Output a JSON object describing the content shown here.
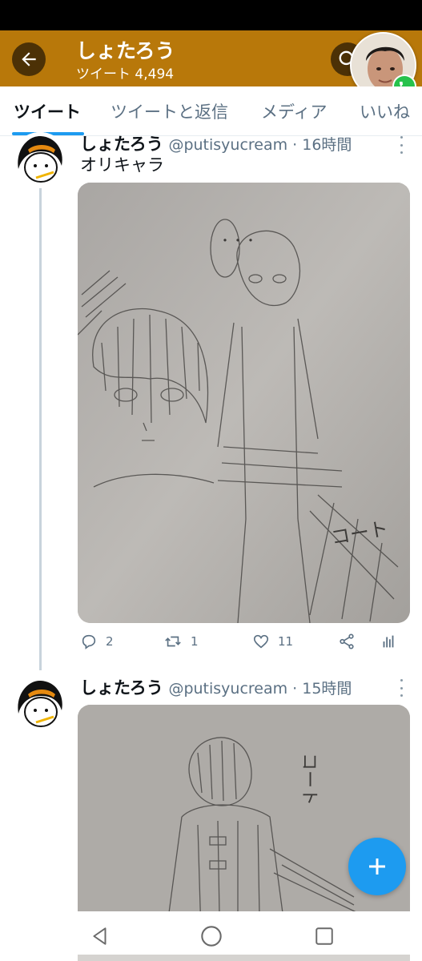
{
  "header": {
    "title": "しょたろう",
    "tweet_count": "ツイート 4,494",
    "back_icon": "arrow-left-icon",
    "search_icon": "search-icon",
    "background_color": "#b8780a"
  },
  "tabs": [
    {
      "label": "ツイート",
      "active": true
    },
    {
      "label": "ツイートと返信",
      "active": false
    },
    {
      "label": "メディア",
      "active": false
    },
    {
      "label": "いいね",
      "active": false
    }
  ],
  "tweets": [
    {
      "name": "しょたろう",
      "handle": "@putisyucream · 16時間",
      "text": "オリキャラ",
      "image_texts": [
        "・・・",
        "コート"
      ],
      "replies": "2",
      "retweets": "1",
      "likes": "11"
    },
    {
      "name": "しょたろう",
      "handle": "@putisyucream · 15時間",
      "text": "",
      "image_texts": [
        "コート"
      ]
    }
  ],
  "fab": {
    "icon": "plus-icon",
    "color": "#1d9bf0"
  },
  "nav": {
    "back_icon": "nav-back-icon",
    "home_icon": "nav-home-icon",
    "recents_icon": "nav-recents-icon"
  },
  "call_bubble": {
    "badge_icon": "phone-icon",
    "badge_color": "#27c24c"
  }
}
